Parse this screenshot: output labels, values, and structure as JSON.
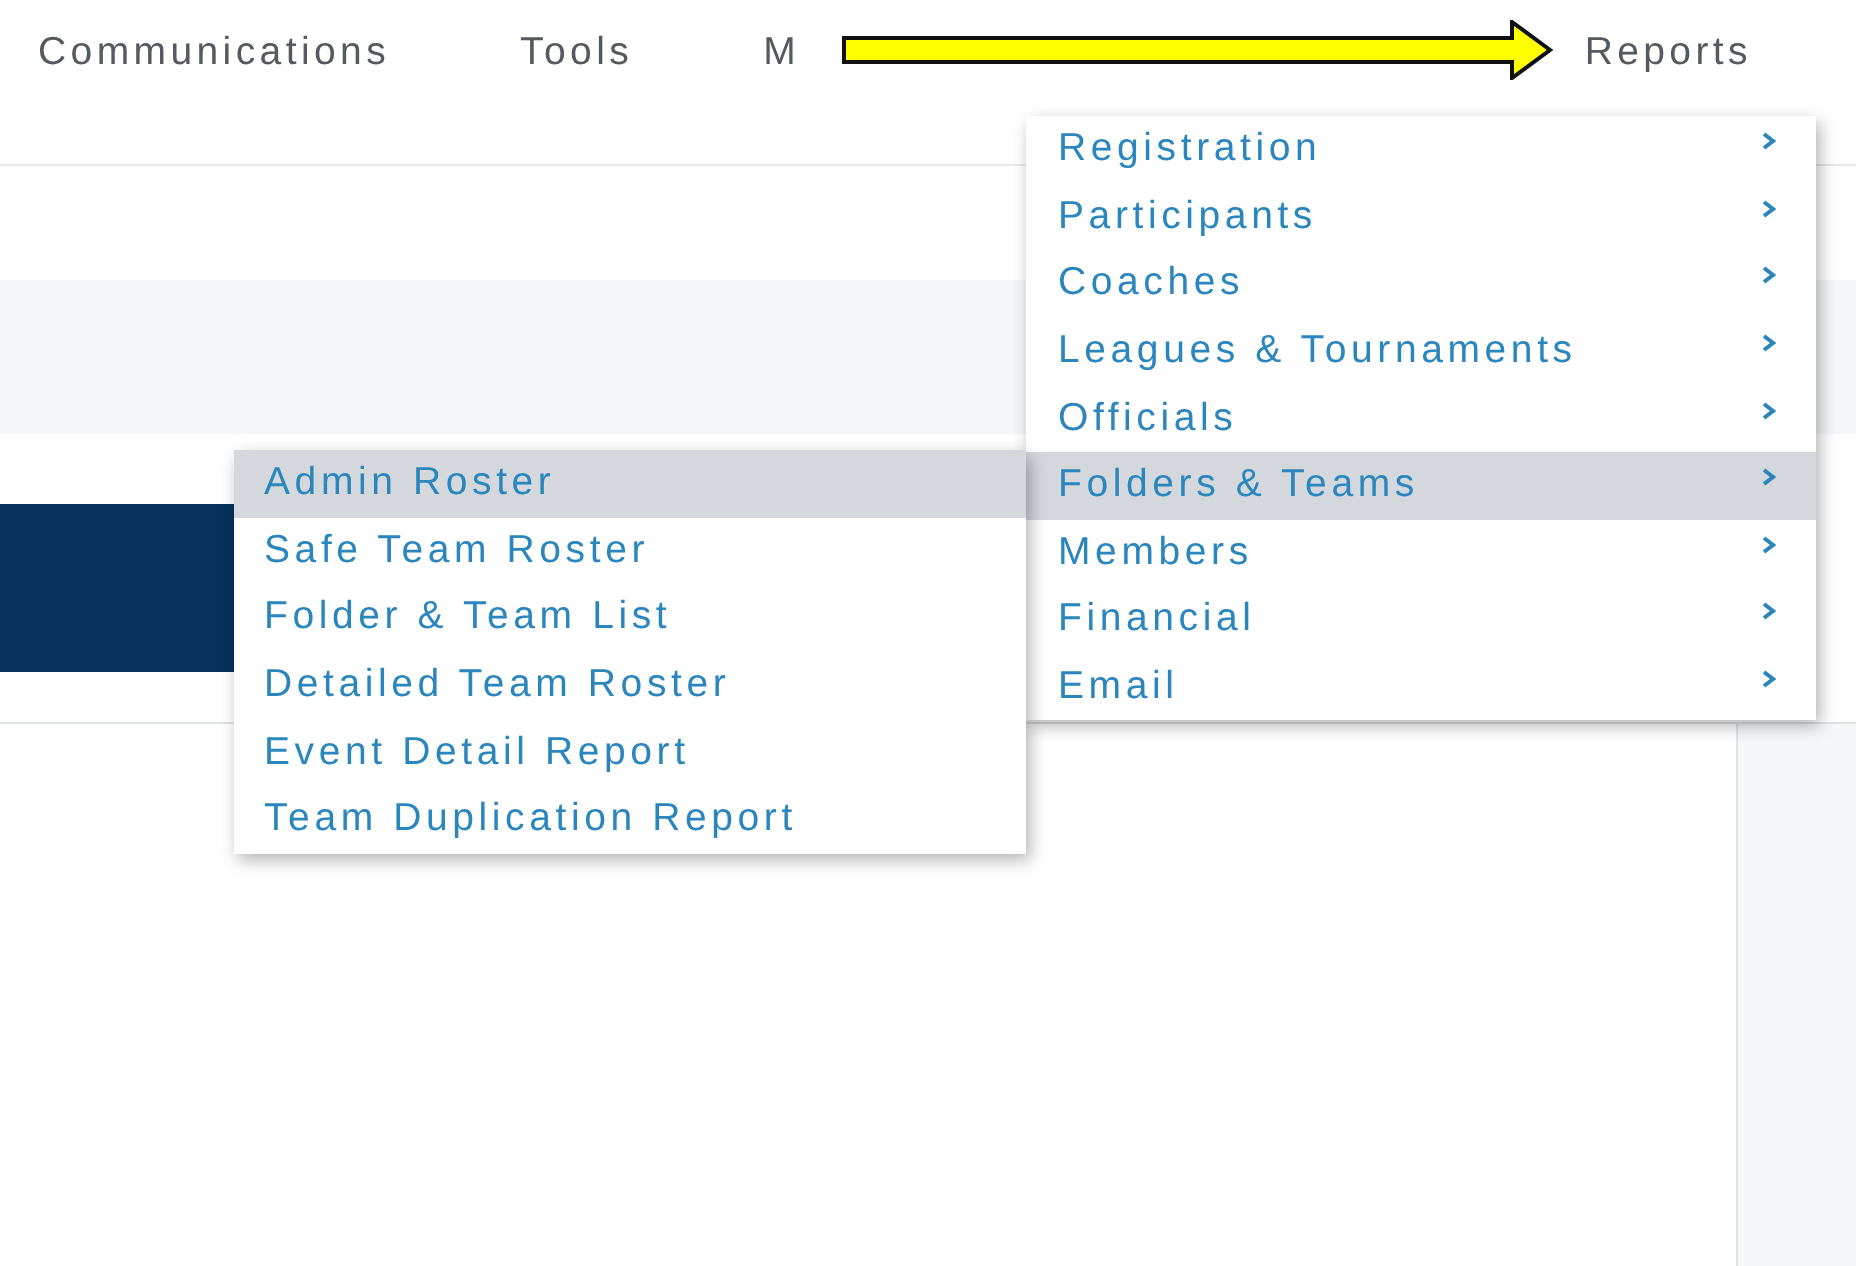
{
  "nav": [
    {
      "label": "Communications"
    },
    {
      "label": "Tools"
    },
    {
      "label": "M"
    },
    {
      "label": "Reports"
    }
  ],
  "reports_menu": {
    "items": [
      {
        "label": "Registration",
        "selected": false
      },
      {
        "label": "Participants",
        "selected": false
      },
      {
        "label": "Coaches",
        "selected": false
      },
      {
        "label": "Leagues & Tournaments",
        "selected": false
      },
      {
        "label": "Officials",
        "selected": false
      },
      {
        "label": "Folders & Teams",
        "selected": true
      },
      {
        "label": "Members",
        "selected": false
      },
      {
        "label": "Financial",
        "selected": false
      },
      {
        "label": "Email",
        "selected": false
      }
    ]
  },
  "submenu": {
    "items": [
      {
        "label": "Admin Roster",
        "selected": true
      },
      {
        "label": "Safe Team Roster",
        "selected": false
      },
      {
        "label": "Folder & Team List",
        "selected": false
      },
      {
        "label": "Detailed Team Roster",
        "selected": false
      },
      {
        "label": "Event Detail Report",
        "selected": false
      },
      {
        "label": "Team Duplication Report",
        "selected": false
      }
    ]
  }
}
